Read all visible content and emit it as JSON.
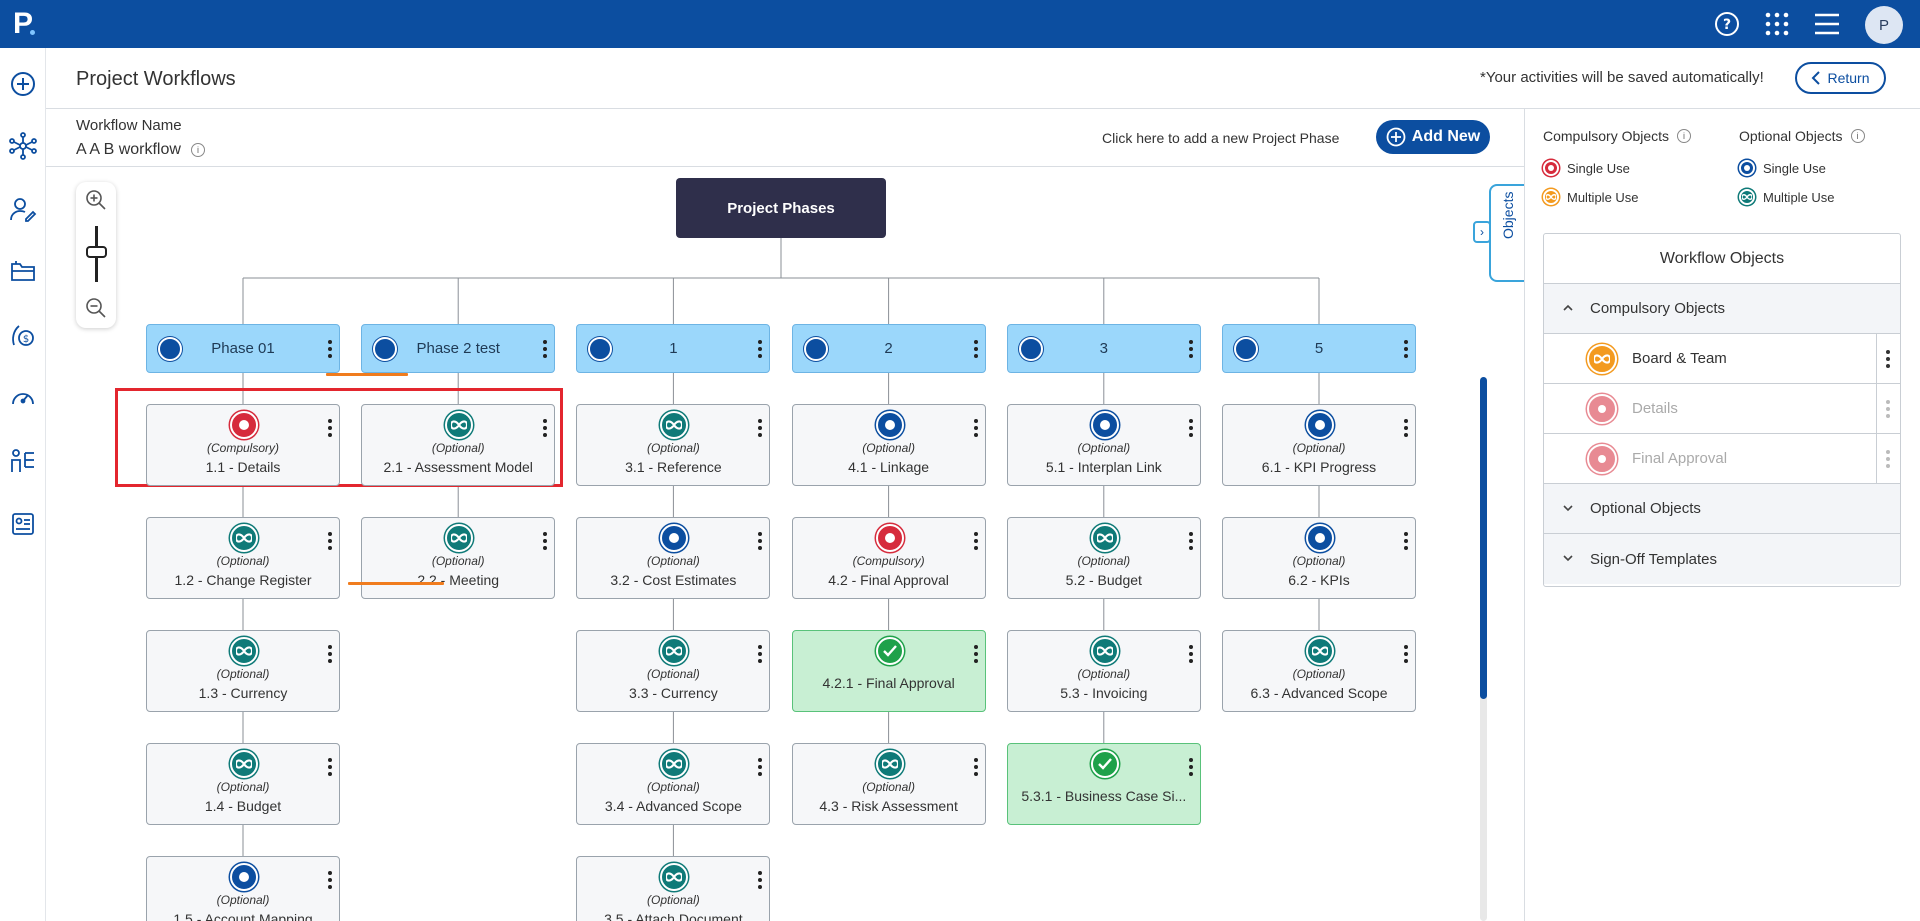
{
  "app": {
    "logo": "P",
    "avatar": "P"
  },
  "header": {
    "title": "Project Workflows",
    "autosave_note": "*Your activities will be saved automatically!",
    "return_label": "Return"
  },
  "workflow": {
    "name_label": "Workflow Name",
    "name_value": "A A B workflow",
    "add_hint": "Click here to add a new Project Phase",
    "add_new_label": "Add New"
  },
  "tree": {
    "root": "Project Phases",
    "phases": [
      {
        "name": "Phase 01",
        "cards": [
          {
            "type": "(Compulsory)",
            "label": "1.1 - Details",
            "icon": "single-red"
          },
          {
            "type": "(Optional)",
            "label": "1.2 - Change Register",
            "icon": "multi-teal"
          },
          {
            "type": "(Optional)",
            "label": "1.3 - Currency",
            "icon": "multi-teal"
          },
          {
            "type": "(Optional)",
            "label": "1.4 - Budget",
            "icon": "multi-teal"
          },
          {
            "type": "(Optional)",
            "label": "1.5 - Account Mapping",
            "icon": "single-blue"
          }
        ]
      },
      {
        "name": "Phase 2 test",
        "cards": [
          {
            "type": "(Optional)",
            "label": "2.1 - Assessment Model",
            "icon": "multi-teal"
          },
          {
            "type": "(Optional)",
            "label": "2.2 - Meeting",
            "icon": "multi-teal"
          }
        ]
      },
      {
        "name": "1",
        "cards": [
          {
            "type": "(Optional)",
            "label": "3.1 - Reference",
            "icon": "multi-teal"
          },
          {
            "type": "(Optional)",
            "label": "3.2 - Cost Estimates",
            "icon": "single-blue"
          },
          {
            "type": "(Optional)",
            "label": "3.3 - Currency",
            "icon": "multi-teal"
          },
          {
            "type": "(Optional)",
            "label": "3.4 - Advanced Scope",
            "icon": "multi-teal"
          },
          {
            "type": "(Optional)",
            "label": "3.5 - Attach Document",
            "icon": "multi-teal"
          }
        ]
      },
      {
        "name": "2",
        "cards": [
          {
            "type": "(Optional)",
            "label": "4.1 - Linkage",
            "icon": "single-blue"
          },
          {
            "type": "(Compulsory)",
            "label": "4.2 - Final Approval",
            "icon": "single-red"
          },
          {
            "type": "",
            "label": "4.2.1 - Final Approval",
            "icon": "check-green"
          },
          {
            "type": "(Optional)",
            "label": "4.3 - Risk Assessment",
            "icon": "multi-teal"
          }
        ]
      },
      {
        "name": "3",
        "cards": [
          {
            "type": "(Optional)",
            "label": "5.1 - Interplan Link",
            "icon": "single-blue"
          },
          {
            "type": "(Optional)",
            "label": "5.2 - Budget",
            "icon": "multi-teal"
          },
          {
            "type": "(Optional)",
            "label": "5.3 - Invoicing",
            "icon": "multi-teal"
          },
          {
            "type": "",
            "label": "5.3.1 - Business Case Si...",
            "icon": "check-green"
          }
        ]
      },
      {
        "name": "5",
        "cards": [
          {
            "type": "(Optional)",
            "label": "6.1 - KPI Progress",
            "icon": "single-blue"
          },
          {
            "type": "(Optional)",
            "label": "6.2 - KPIs",
            "icon": "single-blue"
          },
          {
            "type": "(Optional)",
            "label": "6.3 - Advanced Scope",
            "icon": "multi-teal"
          }
        ]
      }
    ]
  },
  "objects_tab": {
    "label": "Objects"
  },
  "legend": {
    "compulsory_title": "Compulsory Objects",
    "optional_title": "Optional Objects",
    "single_use": "Single Use",
    "multiple_use": "Multiple Use"
  },
  "workflow_objects": {
    "title": "Workflow Objects",
    "compulsory_section": "Compulsory Objects",
    "optional_section": "Optional Objects",
    "signoff_section": "Sign-Off Templates",
    "items": [
      {
        "label": "Board & Team",
        "enabled": true
      },
      {
        "label": "Details",
        "enabled": false
      },
      {
        "label": "Final Approval",
        "enabled": false
      }
    ]
  },
  "colors": {
    "brand": "#0c4ea0",
    "compulsory": "#d62b3c",
    "multiple_compulsory": "#f39a1f",
    "optional_multi": "#0f7a78",
    "done": "#1fa14a"
  }
}
